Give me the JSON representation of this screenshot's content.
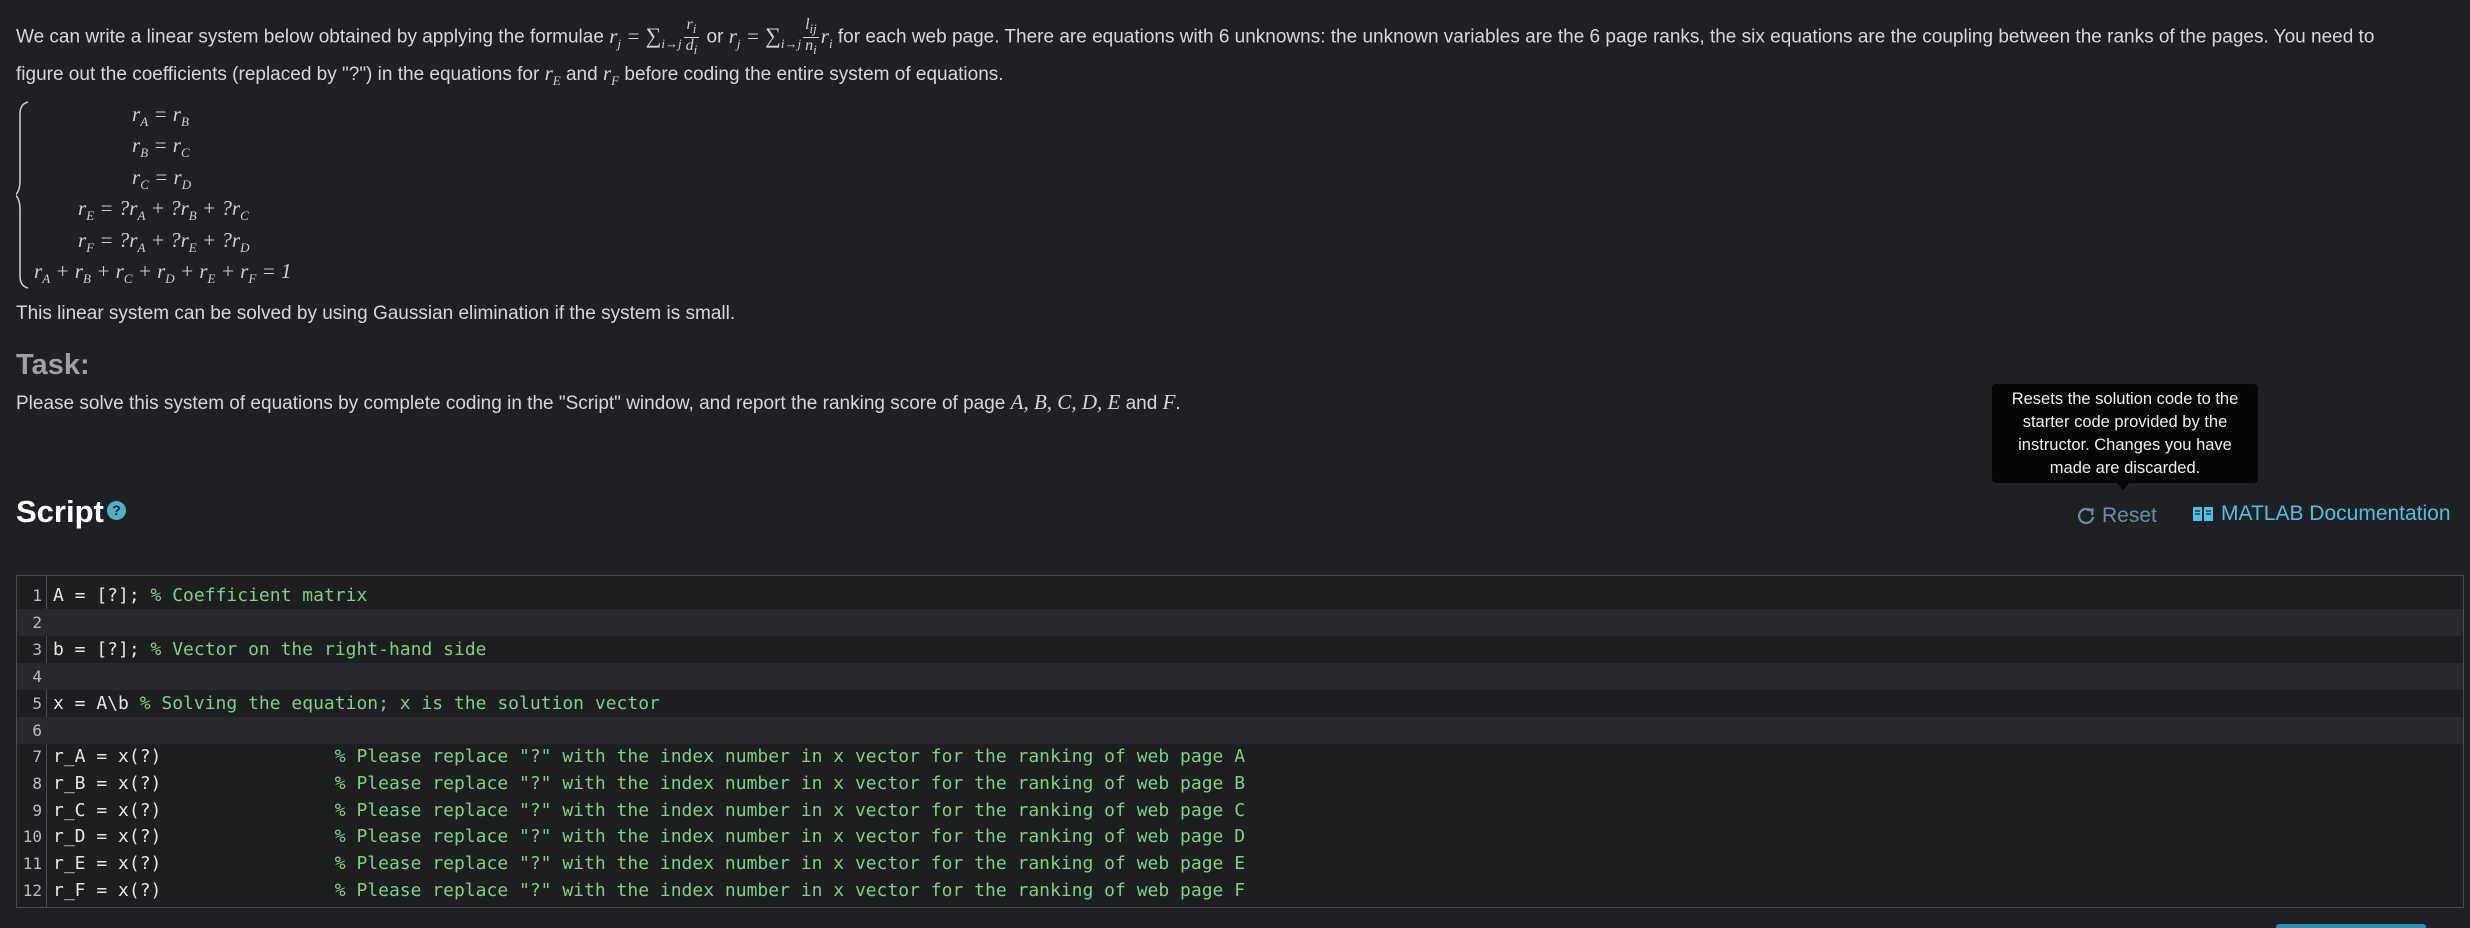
{
  "intro": {
    "line1_start": "We can write a linear system below obtained by applying the formulae",
    "or": "or",
    "line1_end": "for each web page. There are equations with 6 unknowns: the unknown variables are the 6 page ranks, the six equations are the coupling between the ranks of the pages. You need to",
    "line2_start": "figure out the coefficients (replaced by \"?\") in the equations for",
    "and": "and",
    "line2_end": "before coding the entire system of equations."
  },
  "system_note": "This linear system can be solved by using Gaussian elimination if the system is small.",
  "task": {
    "heading": "Task:",
    "text_start": "Please solve this system of equations by complete coding in the \"Script\" window, and report the ranking score of page",
    "and": "and"
  },
  "tooltip": {
    "text": "Resets the solution code to the starter code provided by the instructor. Changes you have made are discarded."
  },
  "script": {
    "heading": "Script",
    "help_label": "?",
    "reset_label": "Reset",
    "doc_label": "MATLAB Documentation"
  },
  "editor": {
    "lines": [
      {
        "num": "1",
        "code": "A = [?]; ",
        "comment": "% Coefficient matrix"
      },
      {
        "num": "2",
        "code": "",
        "comment": ""
      },
      {
        "num": "3",
        "code": "b = [?]; ",
        "comment": "% Vector on the right-hand side"
      },
      {
        "num": "4",
        "code": "",
        "comment": ""
      },
      {
        "num": "5",
        "code": "x = A\\b ",
        "comment": "% Solving the equation; x is the solution vector"
      },
      {
        "num": "6",
        "code": "",
        "comment": ""
      },
      {
        "num": "7",
        "code": "r_A = x(?)                ",
        "comment": "% Please replace \"?\" with the index number in x vector for the ranking of web page A"
      },
      {
        "num": "8",
        "code": "r_B = x(?)                ",
        "comment": "% Please replace \"?\" with the index number in x vector for the ranking of web page B"
      },
      {
        "num": "9",
        "code": "r_C = x(?)                ",
        "comment": "% Please replace \"?\" with the index number in x vector for the ranking of web page C"
      },
      {
        "num": "10",
        "code": "r_D = x(?)                ",
        "comment": "% Please replace \"?\" with the index number in x vector for the ranking of web page D"
      },
      {
        "num": "11",
        "code": "r_E = x(?)                ",
        "comment": "% Please replace \"?\" with the index number in x vector for the ranking of web page E"
      },
      {
        "num": "12",
        "code": "r_F = x(?)                ",
        "comment": "% Please replace \"?\" with the index number in x vector for the ranking of web page F"
      }
    ]
  },
  "colors": {
    "background": "#1e2023",
    "link": "#4fc1e0",
    "comment": "#7fd07f",
    "tooltip_bg": "#050505"
  }
}
